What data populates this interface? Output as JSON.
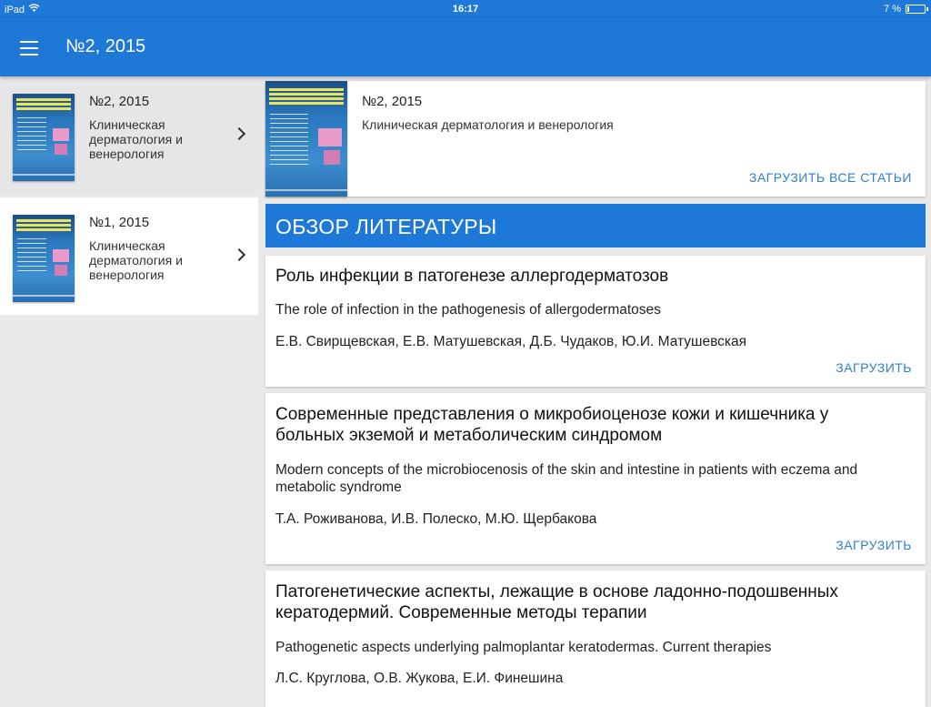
{
  "status_bar": {
    "device": "iPad",
    "time": "16:17",
    "battery": "7 %"
  },
  "app_bar": {
    "title": "№2, 2015"
  },
  "sidebar": {
    "issues": [
      {
        "number": "№2, 2015",
        "journal": "Клиническая дерматология и венерология"
      },
      {
        "number": "№1, 2015",
        "journal": "Клиническая дерматология и венерология"
      }
    ]
  },
  "issue_card": {
    "number": "№2, 2015",
    "journal": "Клиническая дерматология и венерология",
    "download_all_label": "ЗАГРУЗИТЬ ВСЕ СТАТЬИ"
  },
  "section": {
    "title": "ОБЗОР ЛИТЕРАТУРЫ"
  },
  "articles": [
    {
      "title": "Роль инфекции в патогенезе аллергодерматозов",
      "title_en": "The role of infection in the pathogenesis of allergodermatoses",
      "authors": "Е.В. Свирщевская, Е.В. Матушевская, Д.Б. Чудаков, Ю.И. Матушевская",
      "download_label": "ЗАГРУЗИТЬ"
    },
    {
      "title": "Современные представления о микробиоценозе кожи и кишечника у больных экземой и метаболическим синдромом",
      "title_en": "Modern concepts of the microbiocenosis of the skin and intestine in patients with eczema and metabolic syndrome",
      "authors": "Т.А. Роживанова, И.В. Полеско, М.Ю. Щербакова",
      "download_label": "ЗАГРУЗИТЬ"
    },
    {
      "title": "Патогенетические аспекты, лежащие в основе ладонно-подошвенных кератодермий. Современные методы терапии",
      "title_en": "Pathogenetic aspects underlying palmoplantar keratodermas. Current therapies",
      "authors": "Л.С. Круглова, О.В. Жукова, Е.И. Финешина"
    }
  ],
  "colors": {
    "primary": "#1e78d8",
    "link": "#2d7fd0"
  }
}
